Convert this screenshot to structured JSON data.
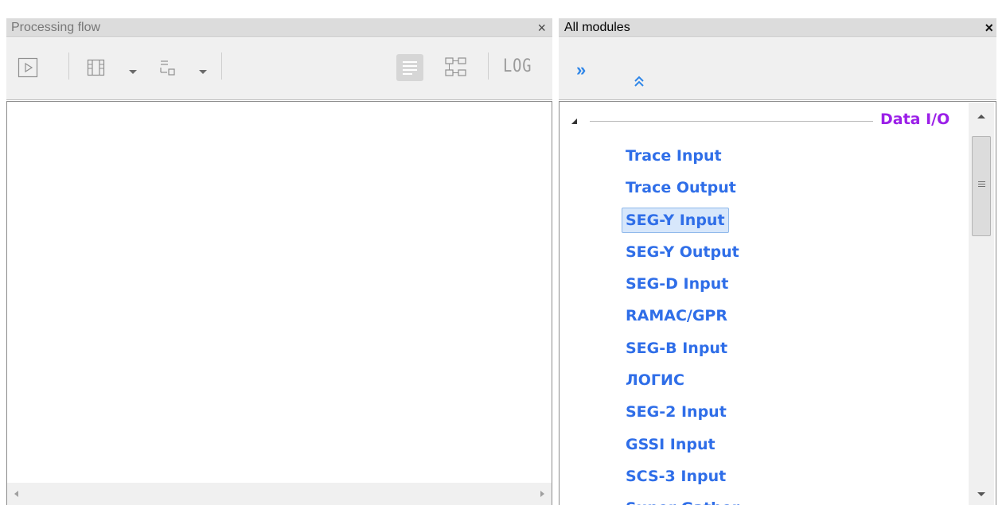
{
  "processing_flow": {
    "title": "Processing flow",
    "close_glyph": "×",
    "toolbar": {
      "icons": [
        "play-icon",
        "film-strip-icon",
        "tree-list-icon",
        "list-view-icon",
        "flow-diagram-icon"
      ],
      "log_label": "LOG"
    }
  },
  "all_modules": {
    "title": "All modules",
    "close_glyph": "×",
    "toolbar": {
      "expand_label": "»",
      "collapse_label": "⌃⌃"
    },
    "group": {
      "label": "Data I/O",
      "items": [
        "Trace Input",
        "Trace Output",
        "SEG-Y Input",
        "SEG-Y Output",
        "SEG-D Input",
        "RAMAC/GPR",
        "SEG-B Input",
        "ЛОГИС",
        "SEG-2 Input",
        "GSSI Input",
        "SCS-3 Input",
        "Super Gather"
      ],
      "selected_item": "SEG-Y Input"
    }
  },
  "colors": {
    "group_label": "#9b1fe8",
    "module_item": "#2f6ee8",
    "toolbar_accent": "#2f86e8"
  }
}
